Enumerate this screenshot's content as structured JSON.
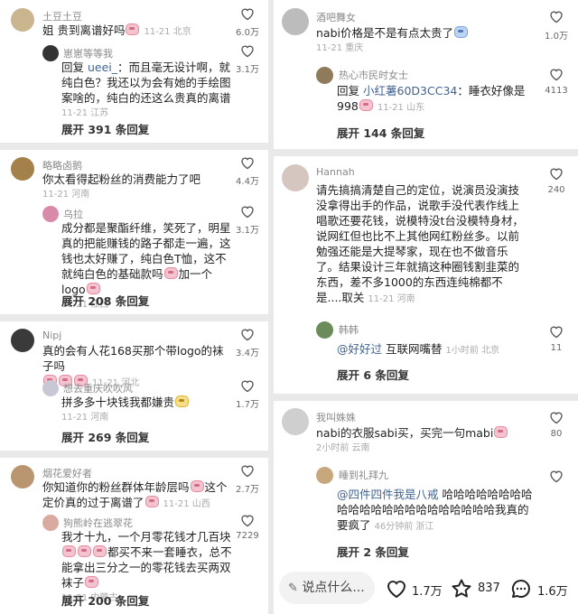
{
  "left": {
    "comments": [
      {
        "name": "土豆土豆",
        "text": "姐 贵到离谱好吗",
        "date": "11-21",
        "loc": "北京",
        "likes": "6.0万",
        "reply": {
          "name": "崽崽等等我",
          "prefix": "回复",
          "to": "ueei_",
          "body": "：而且毫无设计啊，就纯白色？我还以为会有她的手绘图案啥的，纯白的还这么贵真的离谱",
          "date": "11-21",
          "loc": "江苏",
          "likes": "3.1万"
        },
        "expand": "展开 391 条回复"
      },
      {
        "name": "略略卤鹅",
        "text": "你太看得起粉丝的消费能力了吧",
        "date": "11-21",
        "loc": "河南",
        "likes": "4.4万",
        "reply": {
          "name": "乌拉",
          "body": "成分都是聚酯纤维，笑死了，明星真的把能赚钱的路子都走一遍，这钱也太好赚了，纯白色T恤，这不就纯白色的基础款吗",
          "tail": "加一个logo",
          "date": "11-21",
          "loc": "江西",
          "likes": "3.1万"
        },
        "expand": "展开 208 条回复"
      },
      {
        "name": "Nipj",
        "text": "真的会有人花168买那个带logo的袜子吗",
        "date": "11-21",
        "loc": "河北",
        "likes": "3.4万",
        "reply": {
          "name": "想去重庆吹吹风",
          "body": "拼多多十块钱我都嫌贵",
          "date": "11-21",
          "loc": "河南",
          "likes": "1.7万"
        },
        "expand": "展开 269 条回复"
      },
      {
        "name": "烟花爱好者",
        "text": "你知道你的粉丝群体年龄层吗",
        "text2": "这个定价真的过于离谱了",
        "date": "11-21",
        "loc": "山西",
        "likes": "2.7万",
        "reply": {
          "name": "狗熊岭在逃翠花",
          "body": "我才十九，一个月零花钱才几百块",
          "body2": "都买不来一套睡衣，总不能拿出三分之一的零花钱去买两双袜子",
          "date": "11-21",
          "loc": "内蒙古",
          "likes": "7229"
        },
        "expand": "展开 200 条回复"
      }
    ]
  },
  "right": {
    "comments": [
      {
        "name": "酒吧舞女",
        "text": "nabi价格是不是有点太贵了",
        "date": "11-21",
        "loc": "重庆",
        "likes": "1.0万",
        "reply": {
          "name": "热心市民时女士",
          "prefix": "回复",
          "to": "小红薯60D3CC34",
          "body": "：睡衣好像是998",
          "date": "11-21",
          "loc": "山东",
          "likes": "4113"
        },
        "expand": "展开 144 条回复"
      },
      {
        "name": "Hannah",
        "text": "请先搞搞清楚自己的定位，说演员没演技没拿得出手的作品，说歌手没代表作线上唱歌还要花钱，说模特没t台没模特身材，说网红但也比不上其他网红粉丝多。以前勉强还能是大提琴家，现在也不做音乐了。结果设计三年就搞这种圈钱割韭菜的东西，差不多1000的东西连纯棉都不是....取关",
        "date": "11-21",
        "loc": "河南",
        "likes": "240",
        "reply": {
          "name": "韩韩",
          "to": "@好好过",
          "body": "互联网嘴替",
          "time": "1小时前",
          "loc": "北京",
          "likes": "11"
        },
        "expand": "展开 6 条回复"
      },
      {
        "name": "我叫姝姝",
        "text": "nabi的衣服sabi买，买完一句mabi",
        "time": "2小时前",
        "loc": "云南",
        "likes": "80",
        "reply": {
          "name": "睡到礼拜九",
          "to": "@四件四件我是八戒",
          "body": "哈哈哈哈哈哈哈哈哈哈哈哈哈哈哈哈哈哈哈哈哈哈我真的要疯了",
          "time": "46分钟前",
          "loc": "浙江",
          "likes": ""
        },
        "expand": "展开 2 条回复"
      }
    ]
  },
  "bottom_bar": {
    "input_placeholder": "说点什么...",
    "likes": "1.7万",
    "stars": "837",
    "comments": "1.6万"
  },
  "colors": {
    "mention": "#40638f",
    "expand": "#333333",
    "meta": "#aaaaaa"
  }
}
